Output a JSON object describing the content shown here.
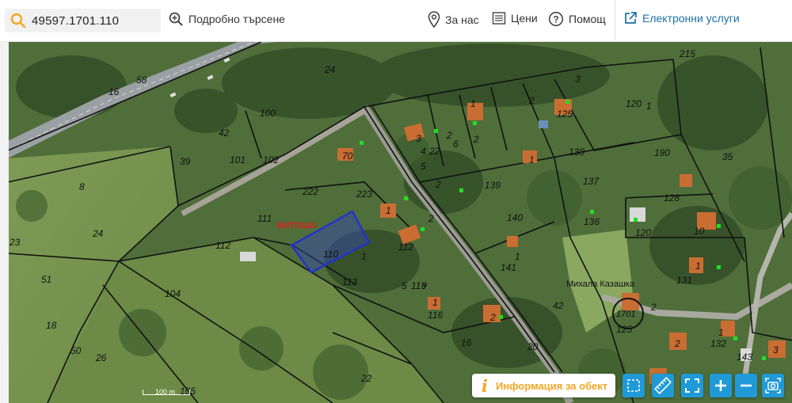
{
  "search": {
    "value": "49597.1701.110"
  },
  "nav": {
    "advanced_search": "Подробно търсене",
    "about": "За нас",
    "prices": "Цени",
    "help": "Помощ",
    "e_services": "Електронни услуги"
  },
  "map": {
    "scale_label": "100 m",
    "parcel_numbers": [
      "215",
      "58",
      "16",
      "24",
      "120",
      "1",
      "100",
      "42",
      "125",
      "3",
      "2",
      "1",
      "70",
      "3",
      "22",
      "6",
      "2",
      "4",
      "5",
      "2",
      "1",
      "2",
      "138",
      "190",
      "35",
      "39",
      "101",
      "102",
      "222",
      "223",
      "1",
      "139",
      "137",
      "128",
      "8",
      "111",
      "110",
      "1",
      "112",
      "2",
      "140",
      "136",
      "120",
      "10",
      "23",
      "24",
      "112",
      "1",
      "5",
      "9",
      "113",
      "113",
      "141",
      "2",
      "131",
      "1",
      "51",
      "104",
      "1",
      "42",
      "125",
      "2",
      "132",
      "18",
      "116",
      "16",
      "50",
      "26",
      "20",
      "2",
      "143",
      "105",
      "22",
      "3",
      "1"
    ],
    "labels": {
      "vitosha": "ВИТОША",
      "village": "Михала Казашка",
      "plan": "1701"
    }
  },
  "controls": {
    "info_button": "Информация за обект"
  },
  "colors": {
    "accent": "#1f9ad6",
    "info": "#f5a623",
    "selected_parcel": "#2233cc",
    "link": "#1d6fa9"
  }
}
